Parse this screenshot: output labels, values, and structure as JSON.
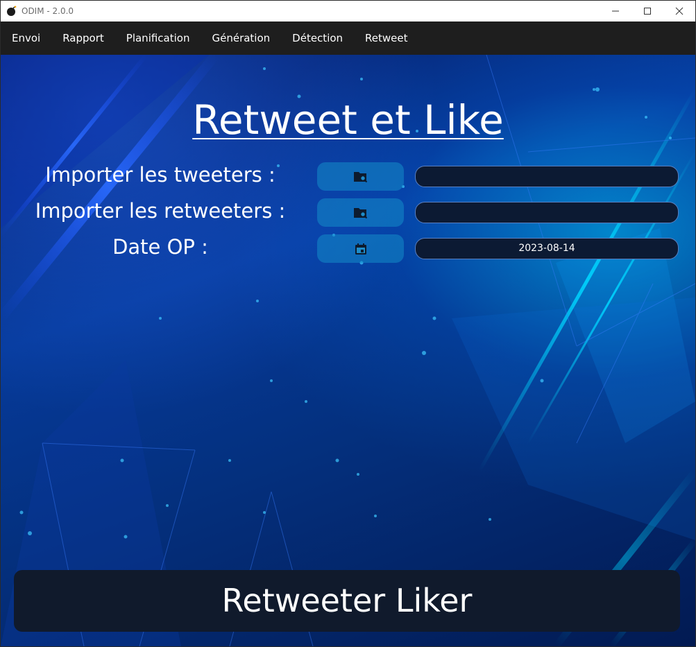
{
  "window": {
    "title": "ODIM - 2.0.0",
    "icons": {
      "app": "bomb-icon",
      "minimize": "minimize-icon",
      "maximize": "maximize-icon",
      "close": "close-icon"
    }
  },
  "menu": {
    "items": [
      {
        "label": "Envoi"
      },
      {
        "label": "Rapport"
      },
      {
        "label": "Planification"
      },
      {
        "label": "Génération"
      },
      {
        "label": "Détection"
      },
      {
        "label": "Retweet"
      }
    ]
  },
  "page": {
    "title": "Retweet et Like"
  },
  "form": {
    "tweeters": {
      "label": "Importer les tweeters :",
      "icon": "folder-search-icon",
      "value": ""
    },
    "retweeters": {
      "label": "Importer les retweeters :",
      "icon": "folder-search-icon",
      "value": ""
    },
    "date": {
      "label": "Date OP :",
      "icon": "calendar-icon",
      "value": "2023-08-14"
    }
  },
  "actions": {
    "submit_label": "Retweeter Liker"
  },
  "colors": {
    "menubar": "#1e1e1e",
    "field_bg": "#0c1a33",
    "button_bg": "#101a2c",
    "icon_button_bg": "#1e8cc8"
  }
}
